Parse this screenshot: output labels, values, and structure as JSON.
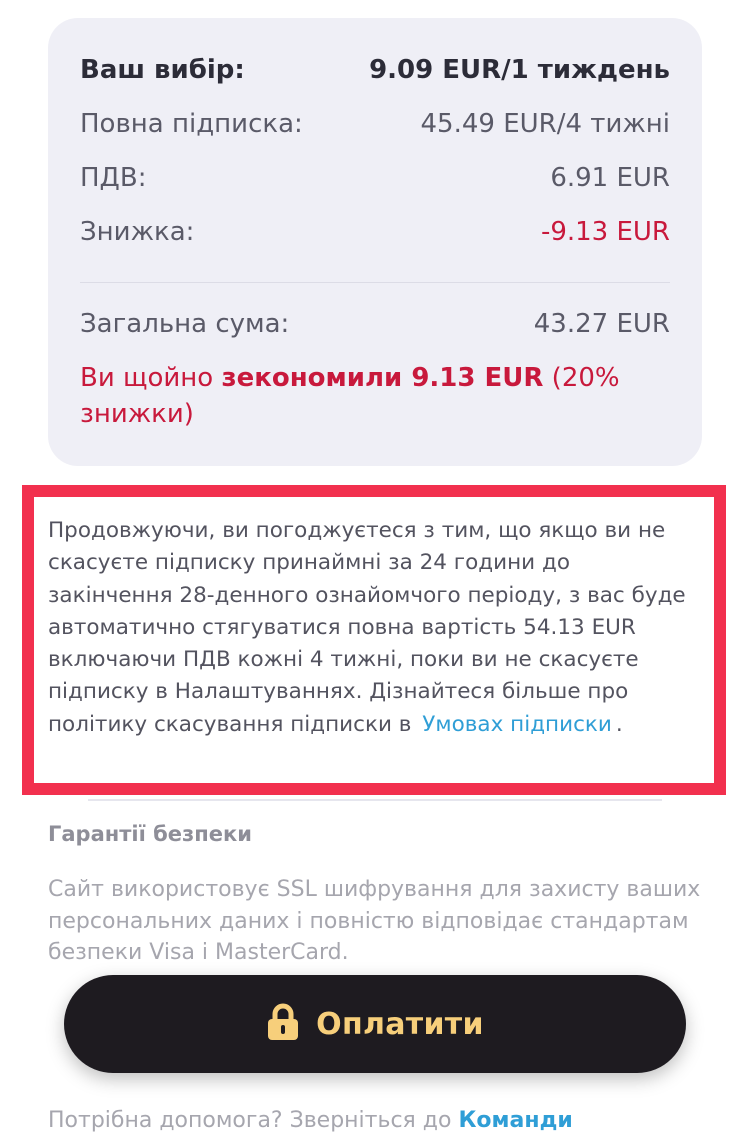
{
  "summary": {
    "choice_label": "Ваш вибір:",
    "choice_value": "9.09 EUR/1 тиждень",
    "full_label": "Повна підписка:",
    "full_value": "45.49 EUR/4 тижні",
    "vat_label": "ПДВ:",
    "vat_value": "6.91 EUR",
    "discount_label": "Знижка:",
    "discount_value": "-9.13 EUR",
    "total_label": "Загальна сума:",
    "total_value": "43.27 EUR",
    "savings_prefix": "Ви щойно ",
    "savings_bold": "зекономили 9.13 EUR",
    "savings_suffix": " (20% знижки)"
  },
  "terms": {
    "text": "Продовжуючи, ви погоджуєтеся з тим, що якщо ви не скасуєте підписку принаймні за 24 години до закінчення 28-денного ознайомчого періоду, з вас буде автоматично стягуватися повна вартість 54.13 EUR включаючи ПДВ кожні 4 тижні, поки ви не скасуєте підписку в Налаштуваннях. Дізнайтеся більше про політику скасування підписки в",
    "link": "Умовах підписки",
    "end": "."
  },
  "security": {
    "title": "Гарантії безпеки",
    "text": "Сайт використовує SSL шифрування для захисту ваших персональних даних і повністю відповідає стандартам безпеки Visa і MasterCard."
  },
  "help": {
    "prefix": "Потрібна допомога? Зверніться до ",
    "link": "Команди"
  },
  "pay_button": {
    "label": "Оплатити",
    "icon": "lock-icon"
  },
  "colors": {
    "accent_red": "#c8193c",
    "link_blue": "#2f9ed6",
    "button_bg": "#1e1b20",
    "button_text": "#f7cf7b",
    "highlight_border": "#f2304e"
  }
}
